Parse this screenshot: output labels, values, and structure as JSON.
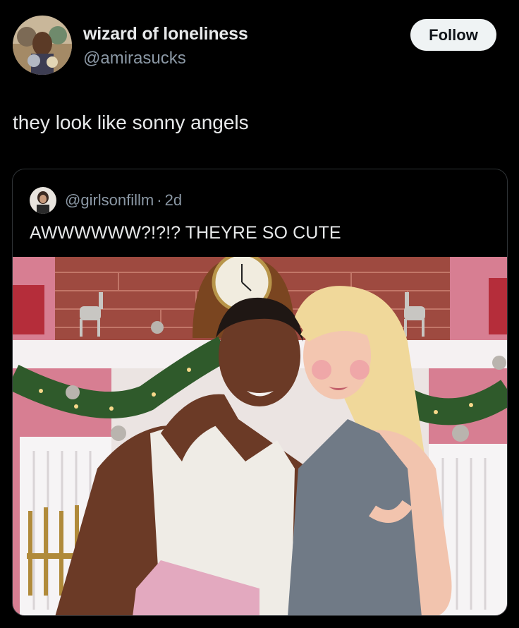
{
  "author": {
    "display_name": "wizard of loneliness",
    "handle": "@amirasucks",
    "avatar_icon": "profile-photo"
  },
  "follow_label": "Follow",
  "tweet": {
    "text": "they look like sonny angels"
  },
  "quoted": {
    "handle": "@girlsonfillm",
    "separator": "·",
    "time": "2d",
    "text": "AWWWWWW?!?!? THEYRE SO CUTE",
    "avatar_icon": "profile-photo"
  },
  "colors": {
    "background": "#000000",
    "text": "#e7e9ea",
    "secondary": "#8b98a5",
    "follow_bg": "#eff3f4",
    "border": "#2f3336"
  }
}
